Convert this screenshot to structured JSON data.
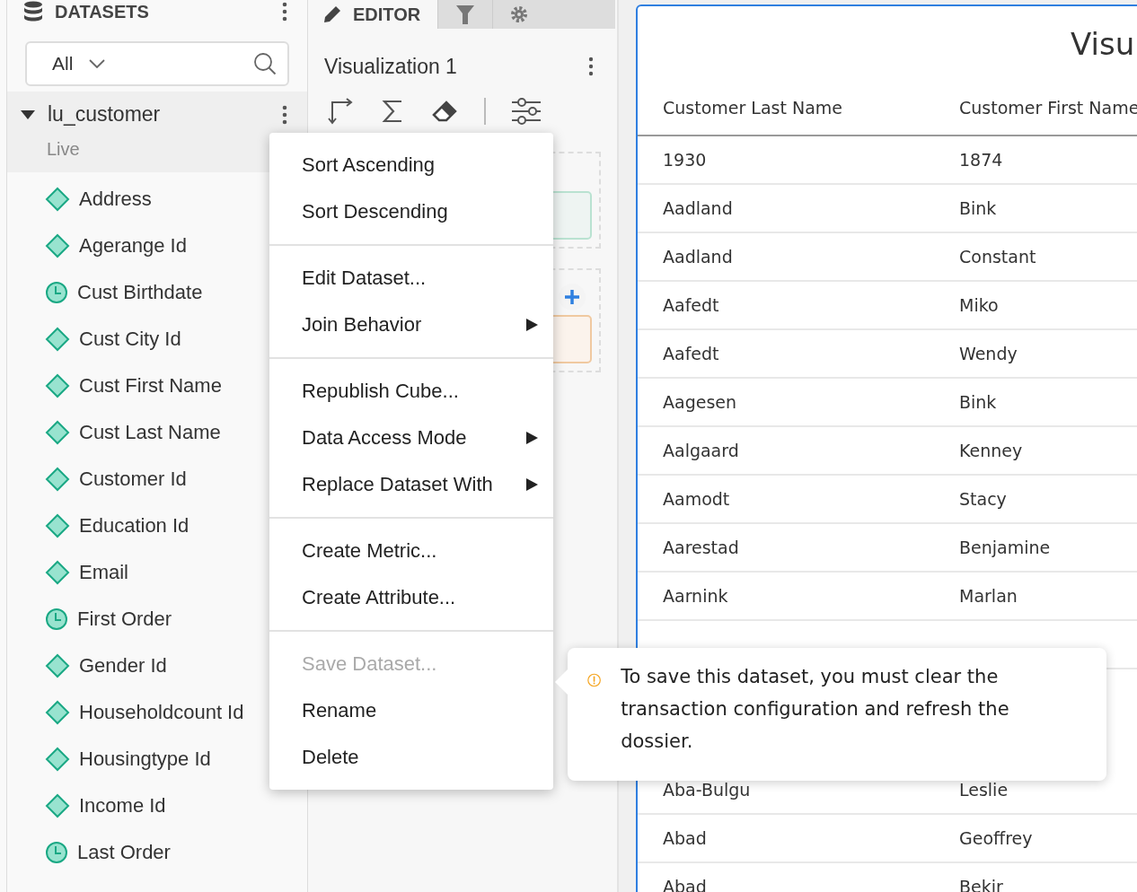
{
  "datasets_panel": {
    "title": "DATASETS",
    "filter": {
      "value": "All"
    },
    "dataset": {
      "name": "lu_customer",
      "status": "Live",
      "expanded": true
    },
    "items": [
      {
        "label": "Address",
        "kind": "attribute"
      },
      {
        "label": "Agerange Id",
        "kind": "attribute"
      },
      {
        "label": "Cust Birthdate",
        "kind": "time"
      },
      {
        "label": "Cust City Id",
        "kind": "attribute"
      },
      {
        "label": "Cust First Name",
        "kind": "attribute"
      },
      {
        "label": "Cust Last Name",
        "kind": "attribute"
      },
      {
        "label": "Customer Id",
        "kind": "attribute"
      },
      {
        "label": "Education Id",
        "kind": "attribute"
      },
      {
        "label": "Email",
        "kind": "attribute"
      },
      {
        "label": "First Order",
        "kind": "time"
      },
      {
        "label": "Gender Id",
        "kind": "attribute"
      },
      {
        "label": "Householdcount Id",
        "kind": "attribute"
      },
      {
        "label": "Housingtype Id",
        "kind": "attribute"
      },
      {
        "label": "Income Id",
        "kind": "attribute"
      },
      {
        "label": "Last Order",
        "kind": "time"
      }
    ]
  },
  "editor_panel": {
    "tabs": [
      {
        "kind": "editor",
        "label": "EDITOR",
        "selected": true
      },
      {
        "kind": "filter",
        "selected": false
      },
      {
        "kind": "format",
        "selected": false
      }
    ],
    "visualization_name": "Visualization 1"
  },
  "visualization": {
    "title": "Visu",
    "table": {
      "columns": [
        "Customer Last Name",
        "Customer First Name"
      ],
      "rows": [
        [
          "1930",
          "1874"
        ],
        [
          "Aadland",
          "Bink"
        ],
        [
          "Aadland",
          "Constant"
        ],
        [
          "Aafedt",
          "Miko"
        ],
        [
          "Aafedt",
          "Wendy"
        ],
        [
          "Aagesen",
          "Bink"
        ],
        [
          "Aalgaard",
          "Kenney"
        ],
        [
          "Aamodt",
          "Stacy"
        ],
        [
          "Aarestad",
          "Benjamine"
        ],
        [
          "Aarnink",
          "Marlan"
        ]
      ],
      "rows_below_popup": [
        [
          "Aba-Bulgu",
          "Leslie"
        ],
        [
          "Abad",
          "Geoffrey"
        ],
        [
          "Abad",
          "Bekir"
        ]
      ]
    }
  },
  "context_menu": {
    "groups": [
      {
        "items": [
          {
            "label": "Sort Ascending",
            "disabled": false,
            "submenu": false
          },
          {
            "label": "Sort Descending",
            "disabled": false,
            "submenu": false
          }
        ]
      },
      {
        "items": [
          {
            "label": "Edit Dataset...",
            "disabled": false,
            "submenu": false
          },
          {
            "label": "Join Behavior",
            "disabled": false,
            "submenu": true
          }
        ]
      },
      {
        "items": [
          {
            "label": "Republish Cube...",
            "disabled": false,
            "submenu": false
          },
          {
            "label": "Data Access Mode",
            "disabled": false,
            "submenu": true
          },
          {
            "label": "Replace Dataset With",
            "disabled": false,
            "submenu": true
          }
        ]
      },
      {
        "items": [
          {
            "label": "Create Metric...",
            "disabled": false,
            "submenu": false
          },
          {
            "label": "Create Attribute...",
            "disabled": false,
            "submenu": false
          }
        ]
      },
      {
        "items": [
          {
            "label": "Save Dataset...",
            "disabled": true,
            "submenu": false
          },
          {
            "label": "Rename",
            "disabled": false,
            "submenu": false
          },
          {
            "label": "Delete",
            "disabled": false,
            "submenu": false
          }
        ]
      }
    ]
  },
  "tooltip": {
    "text": "To save this dataset, you must clear the transaction configuration and refresh the dossier."
  }
}
